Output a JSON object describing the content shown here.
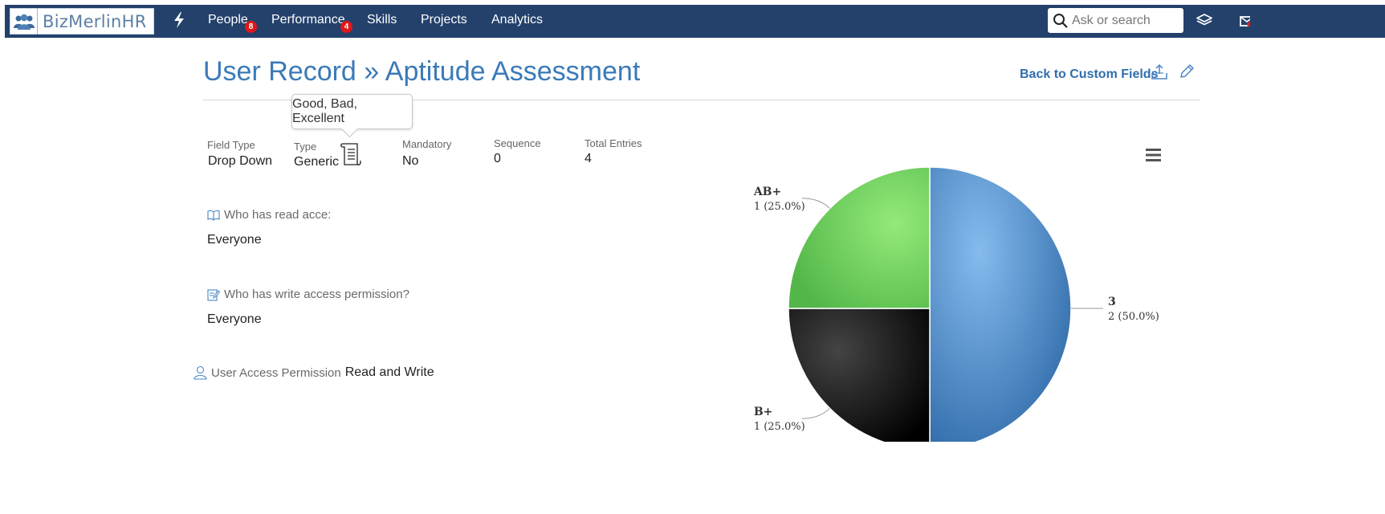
{
  "navbar": {
    "brand": "BizMerlinHR",
    "items": [
      {
        "label": "People",
        "badge": "8"
      },
      {
        "label": "Performance",
        "badge": "4"
      },
      {
        "label": "Skills"
      },
      {
        "label": "Projects"
      },
      {
        "label": "Analytics"
      }
    ],
    "search_placeholder": "Ask or search",
    "icons": [
      "bolt-icon",
      "search-icon",
      "layers-icon",
      "mail-icon"
    ]
  },
  "header": {
    "title": "User Record » Aptitude Assessment",
    "back_link": "Back to Custom Fields",
    "icons": [
      "export-icon",
      "edit-icon"
    ]
  },
  "tooltip": {
    "text": "Good, Bad, Excellent"
  },
  "fields": {
    "field_type": {
      "label": "Field Type",
      "value": "Drop Down"
    },
    "type": {
      "label": "Type",
      "value": "Generic"
    },
    "mandatory": {
      "label": "Mandatory",
      "value": "No"
    },
    "sequence": {
      "label": "Sequence",
      "value": "0"
    },
    "total_entries": {
      "label": "Total Entries",
      "value": "4"
    }
  },
  "permissions": {
    "read": {
      "label": "Who has read acce:",
      "value": "Everyone"
    },
    "write": {
      "label": "Who has write access permission?",
      "value": "Everyone"
    },
    "user_access": {
      "label": "User Access Permission",
      "value": "Read and Write"
    }
  },
  "chart_data": {
    "type": "pie",
    "slices": [
      {
        "name": "3",
        "value": 2,
        "percent": 50.0,
        "label": "2 (50.0%)",
        "color": "#4a86c5"
      },
      {
        "name": "B+",
        "value": 1,
        "percent": 25.0,
        "label": "1 (25.0%)",
        "color": "#151515"
      },
      {
        "name": "AB+",
        "value": 1,
        "percent": 25.0,
        "label": "1 (25.0%)",
        "color": "#6bcb5a"
      }
    ],
    "colors": {
      "blue": "#4a86c5",
      "black": "#151515",
      "green": "#6bcb5a"
    }
  },
  "colors": {
    "navbar": "#23416b",
    "title": "#3a7ab8",
    "link": "#2f6fae",
    "badge": "#e01818"
  }
}
